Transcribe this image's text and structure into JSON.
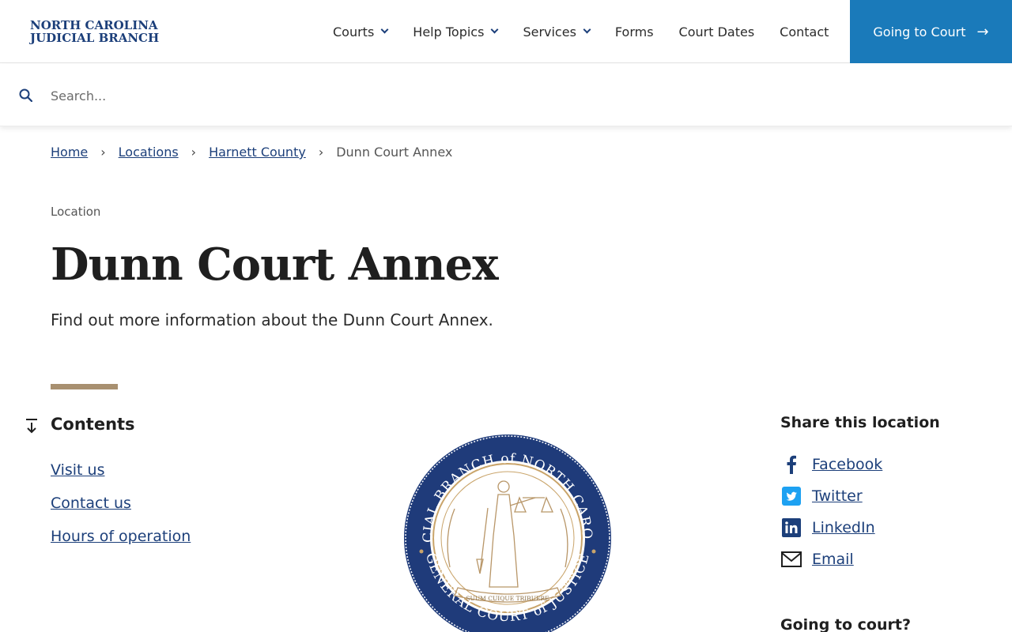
{
  "header": {
    "logo_line1": "NORTH CAROLINA",
    "logo_line2": "JUDICIAL BRANCH",
    "nav": [
      {
        "label": "Courts"
      },
      {
        "label": "Help Topics"
      },
      {
        "label": "Services"
      },
      {
        "label": "Forms"
      },
      {
        "label": "Court Dates"
      },
      {
        "label": "Contact"
      }
    ],
    "cta_label": "Going to Court",
    "cta_arrow": "→",
    "cta_color": "#1a7aba"
  },
  "search": {
    "placeholder": "Search..."
  },
  "breadcrumb": {
    "items": [
      "Home",
      "Locations",
      "Harnett County"
    ],
    "current": "Dunn Court Annex",
    "separator": "›"
  },
  "page": {
    "kicker": "Location",
    "title": "Dunn Court Annex",
    "intro": "Find out more information about the Dunn Court Annex."
  },
  "contents": {
    "title": "Contents",
    "items": [
      "Visit us",
      "Contact us",
      "Hours of operation"
    ]
  },
  "seal": {
    "top_text": "JUDICIAL BRANCH of NORTH CAROLINA",
    "bottom_text": "GENERAL COURT of JUSTICE",
    "motto": "SUUM CUIQUE TRIBUERE"
  },
  "share": {
    "title": "Share this location",
    "items": [
      {
        "label": "Facebook",
        "icon": "facebook-icon"
      },
      {
        "label": "Twitter",
        "icon": "twitter-icon"
      },
      {
        "label": "LinkedIn",
        "icon": "linkedin-icon"
      },
      {
        "label": "Email",
        "icon": "email-icon"
      }
    ],
    "next_heading": "Going to court?"
  },
  "colors": {
    "brand_blue": "#1c3f7a",
    "accent_gold": "#a89070",
    "link": "#1c3f7a"
  }
}
